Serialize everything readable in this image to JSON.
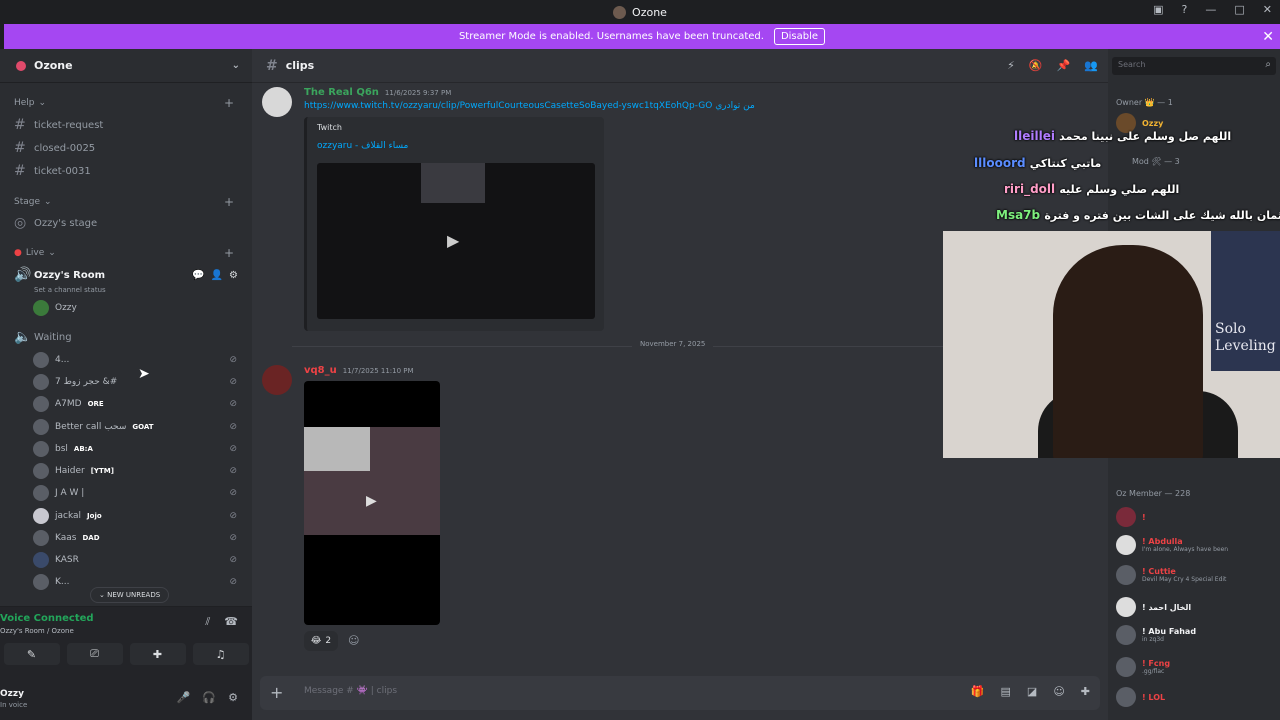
{
  "window": {
    "title": "Ozone"
  },
  "banner": {
    "text": "Streamer Mode is enabled. Usernames have been truncated.",
    "button": "Disable"
  },
  "guild": {
    "name": "Ozone"
  },
  "categories": {
    "help": "Help",
    "stage": "Stage",
    "live": "Live"
  },
  "channels": {
    "ticket_request": "ticket-request",
    "closed": "closed-0025",
    "ticket_0031": "ticket-0031",
    "stage": "Ozzy's stage",
    "room": "Ozzy's Room",
    "room_status": "Set a channel status",
    "waiting": "Waiting"
  },
  "room_users": [
    {
      "name": "Ozzy"
    }
  ],
  "waiting_users": [
    {
      "name": "4...",
      "tag": ""
    },
    {
      "name": "7 حجر زوط &#",
      "tag": ""
    },
    {
      "name": "A7MD",
      "tag": "ORE"
    },
    {
      "name": "Better call سحب",
      "tag": "GOAT"
    },
    {
      "name": "bsl",
      "tag": "AB:A"
    },
    {
      "name": "Haider",
      "tag": "[YTM]"
    },
    {
      "name": "J A W |",
      "tag": ""
    },
    {
      "name": "jackal",
      "tag": "Jojo"
    },
    {
      "name": "Kaas",
      "tag": "DAD"
    },
    {
      "name": "KASR",
      "tag": ""
    },
    {
      "name": "K...",
      "tag": ""
    }
  ],
  "new_unreads": "NEW UNREADS",
  "voice": {
    "title": "Voice Connected",
    "location": "Ozzy's Room / Ozone"
  },
  "user": {
    "name": "Ozzy",
    "status": "In voice"
  },
  "channel_header": {
    "name": "clips",
    "search_placeholder": "Search"
  },
  "messages": [
    {
      "author": "The Real Q6n",
      "author_color": "#3ba55d",
      "timestamp": "11/6/2025 9:37 PM",
      "link": "https://www.twitch.tv/ozzyaru/clip/PowerfulCourteousCasetteSoBayed-yswc1tqXEohQp-GO من توادري",
      "embed_provider": "Twitch",
      "embed_title": "ozzyaru - مساء القلاف"
    },
    {
      "author": "vq8_u",
      "author_color": "#ed4245",
      "timestamp": "11/7/2025 11:10 PM",
      "reaction_count": "2"
    }
  ],
  "date_divider": "November 7, 2025",
  "composer": {
    "placeholder": "Message # 👾 | clips"
  },
  "members": {
    "owner_header": "Owner 👑 — 1",
    "owner": "Ozzy",
    "mod_header": "Mod 🛠 — 3",
    "oz_header": "Oz Member — 228",
    "list": [
      {
        "name": "!",
        "status": "",
        "color": "#ed4245"
      },
      {
        "name": "! Abdulla",
        "status": "I'm alone, Always have been",
        "color": "#ed4245"
      },
      {
        "name": "! Cuttie",
        "status": "Devil May Cry 4 Special Edit",
        "color": "#ed4245"
      },
      {
        "name": "! الخال احمد",
        "status": "",
        "color": "#f2f3f5"
      },
      {
        "name": "! Abu Fahad",
        "status": "in zq3d",
        "color": "#f2f3f5"
      },
      {
        "name": "! Fcng",
        "status": ".gg/flac",
        "color": "#ed4245"
      },
      {
        "name": "! LOL",
        "status": "",
        "color": "#ed4245"
      }
    ]
  },
  "chat_overlay": [
    {
      "user": "lleillei",
      "user_color": "#b07cff",
      "text": "اللهم صل وسلم على نبينا محمد"
    },
    {
      "user": "lllooord",
      "user_color": "#5b8dff",
      "text": "ماتبي كنتاكي"
    },
    {
      "user": "riri_doll",
      "user_color": "#ff9ec8",
      "text": "اللهم صلي وسلم عليه"
    },
    {
      "user": "Msa7b",
      "user_color": "#7ef07e",
      "text": "عثمان بالله شيك على الشات بين فتره و فترة"
    }
  ],
  "camera": {
    "poster_text": "Solo Leveling"
  }
}
